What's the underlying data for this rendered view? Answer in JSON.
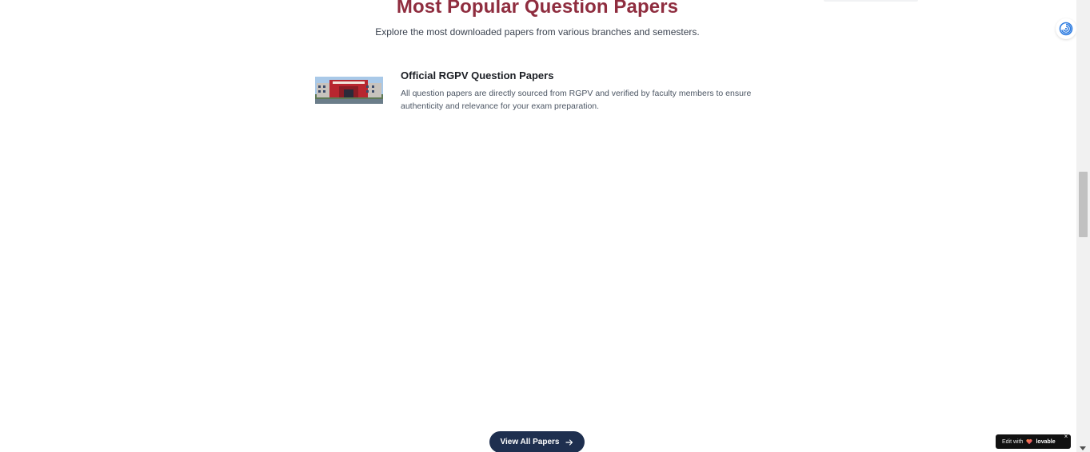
{
  "section": {
    "title": "Most Popular Question Papers",
    "subtitle": "Explore the most downloaded papers from various branches and semesters."
  },
  "feature": {
    "image_name": "rgpv-campus-photo",
    "title": "Official RGPV Question Papers",
    "description": "All question papers are directly sourced from RGPV and verified by faculty members to ensure authenticity and relevance for your exam preparation."
  },
  "cta": {
    "label": "View All Papers",
    "icon": "arrow-right-icon"
  },
  "badge": {
    "prefix": "Edit with",
    "brand": "lovable",
    "close": "×"
  },
  "colors": {
    "title": "#8f2d3f",
    "button": "#1e2f4f",
    "badge_bg": "#111111"
  }
}
